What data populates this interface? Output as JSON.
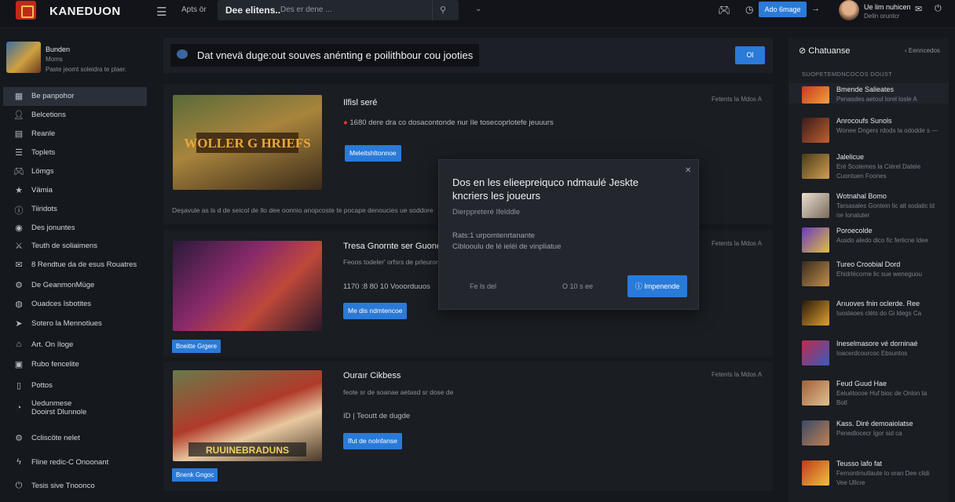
{
  "header": {
    "logo_text": "KANEDUON",
    "nav_link": "Apts ör",
    "search_bold": "Dee elitens..",
    "search_placeholder": "Des er dene ...",
    "action_button": "Ado 6mage",
    "user_name": "Ue lim nuhicen",
    "user_sub": "Delin oruntcr"
  },
  "sidebar": {
    "profile": {
      "name": "Bunden",
      "line2": "Moms",
      "line3": "Paste jeomt soleidra te plaer."
    },
    "items": [
      {
        "label": "Be panpohor",
        "icon": "grid-icon",
        "active": true
      },
      {
        "label": "Belcetions",
        "icon": "user-icon"
      },
      {
        "label": "Reanle",
        "icon": "document-icon"
      },
      {
        "label": "Toplets",
        "icon": "list-icon"
      },
      {
        "label": "Lömgs",
        "icon": "gamepad-icon"
      },
      {
        "label": "Vämia",
        "icon": "star-icon"
      },
      {
        "label": "Tiiridots",
        "icon": "info-icon"
      },
      {
        "label": "Des jonuntes",
        "icon": "eye-icon"
      },
      {
        "label": "Teuth de soliaimens",
        "icon": "sword-icon"
      },
      {
        "label": "8 Rendtue da de esus Rouatres",
        "icon": "mail-icon"
      },
      {
        "label": "De GeanmonMüge",
        "icon": "settings-icon"
      },
      {
        "label": "Ouadces Isbotites",
        "icon": "globe-icon"
      },
      {
        "label": "Sotero la Mennotiues",
        "icon": "cursor-icon"
      },
      {
        "label": "Art. On Iloge",
        "icon": "home-icon"
      },
      {
        "label": "Rubo fencelite",
        "icon": "calendar-icon"
      },
      {
        "label": "Pottos",
        "icon": "page-icon"
      },
      {
        "label": "Uedunmese\nDooirst Dlunnole",
        "icon": "color-wheel-icon"
      },
      {
        "label": "Ccliscöte nelet",
        "icon": "gear-icon"
      },
      {
        "label": "Fline redic-C Onoonant",
        "icon": "lightning-icon"
      },
      {
        "label": "Tesis sive Tnoonco",
        "icon": "power-icon"
      }
    ]
  },
  "promo": {
    "text": "Dat vnevä duge:out souves anénting e poilithbour cou jooties",
    "button": "Ol"
  },
  "cards": [
    {
      "title": "Ilfisl seré",
      "meta": "Fetents la Mdos A",
      "line": "1680  dere dra co dosacontonde nur Ile tosecoprlotefe jeuuurs",
      "button": "Meleitshltonnoe",
      "desc": "Deşavule as ls d de seicol de llo dee oonnio anopcoste te pocape denoucies ue soddore",
      "tag": "",
      "image_text": "WOLLER G HRIEFS"
    },
    {
      "title": "Tresa Gnornte ser Guonetin",
      "meta": "Fetents la Mdos A",
      "subline": "Feoos todeler' orfsrs de prleuror",
      "line": "1170 :8  80  10  Vooorduuos",
      "button": "Me dis ndmtencoe",
      "desc": "",
      "tag": "Bneitte Grgere",
      "image_text": ""
    },
    {
      "title": "Ouraır Cikbess",
      "meta": "Fetents la Mdos A",
      "subline": "feote sr de soanae aetasd sr dose de",
      "line": "ID | Teoutt de dugde",
      "button": "Ifut de nolnfanse",
      "desc": "",
      "tag": "Bnenk Gngoc",
      "image_text": "RUUINEBRADUNS"
    }
  ],
  "modal": {
    "title": "Dos en les elieepreiquco ndmaulé Jeskte kncriers les joueurs",
    "subtitle": "Dierppreteré Ifelddle",
    "line1": "Rats:1 urpomtenrtanante",
    "line2": "Ciblooulu de lé ieléi de vinpliatue",
    "option_a": "Fe ls del",
    "option_b": "O  10 s ee",
    "button": "Impenende"
  },
  "right_panel": {
    "title": "Chatuanse",
    "link": "Eenncedos",
    "section": "SUOPETEMDNCOCOS DOUST",
    "items": [
      {
        "name": "Bmende Salieates",
        "sub": "Penasdes aetoul lorel losle A",
        "highlight": true
      },
      {
        "name": "Anrocoufs Sunols",
        "sub": "Wonee Dngers rdods la ododde s —"
      },
      {
        "name": "Jalelicue",
        "sub": "Eré Scotemes la Ciérel Datele Cuontuen Foones"
      },
      {
        "name": "Wotnahal Bomo",
        "sub": "Tarsasales Gontein lic alt sodatic ld ne Ionaluter"
      },
      {
        "name": "Poroecolde",
        "sub": "Ausdo aledo dico fic ferlicne ldee"
      },
      {
        "name": "Tureo Croobial Dord",
        "sub": "Ehidrlécorne lic sue weneguou"
      },
      {
        "name": "Arıuoves fnin oclerde. Ree",
        "sub": "Iuoslaoes cléts do Gi ldegs Ca"
      },
      {
        "name": "Ineselmasore vé dorninaé",
        "sub": "Ioacerdcourcoc Ebsuntos"
      },
      {
        "name": "Feud Guud Hae",
        "sub": "Eeiuétocoe Huf bioc de Onlon ta Botl"
      },
      {
        "name": "Kass. Diré demoaiolatse",
        "sub": "Penedlocecr Igor sid ca"
      },
      {
        "name": "Teusso lafo fat",
        "sub": "Fernontrnutlaute lo oran Dee clidi Vee Ullcre"
      }
    ]
  },
  "colors": {
    "accent": "#2a7ad8",
    "background": "#15181d",
    "panel": "#1a1d22"
  }
}
